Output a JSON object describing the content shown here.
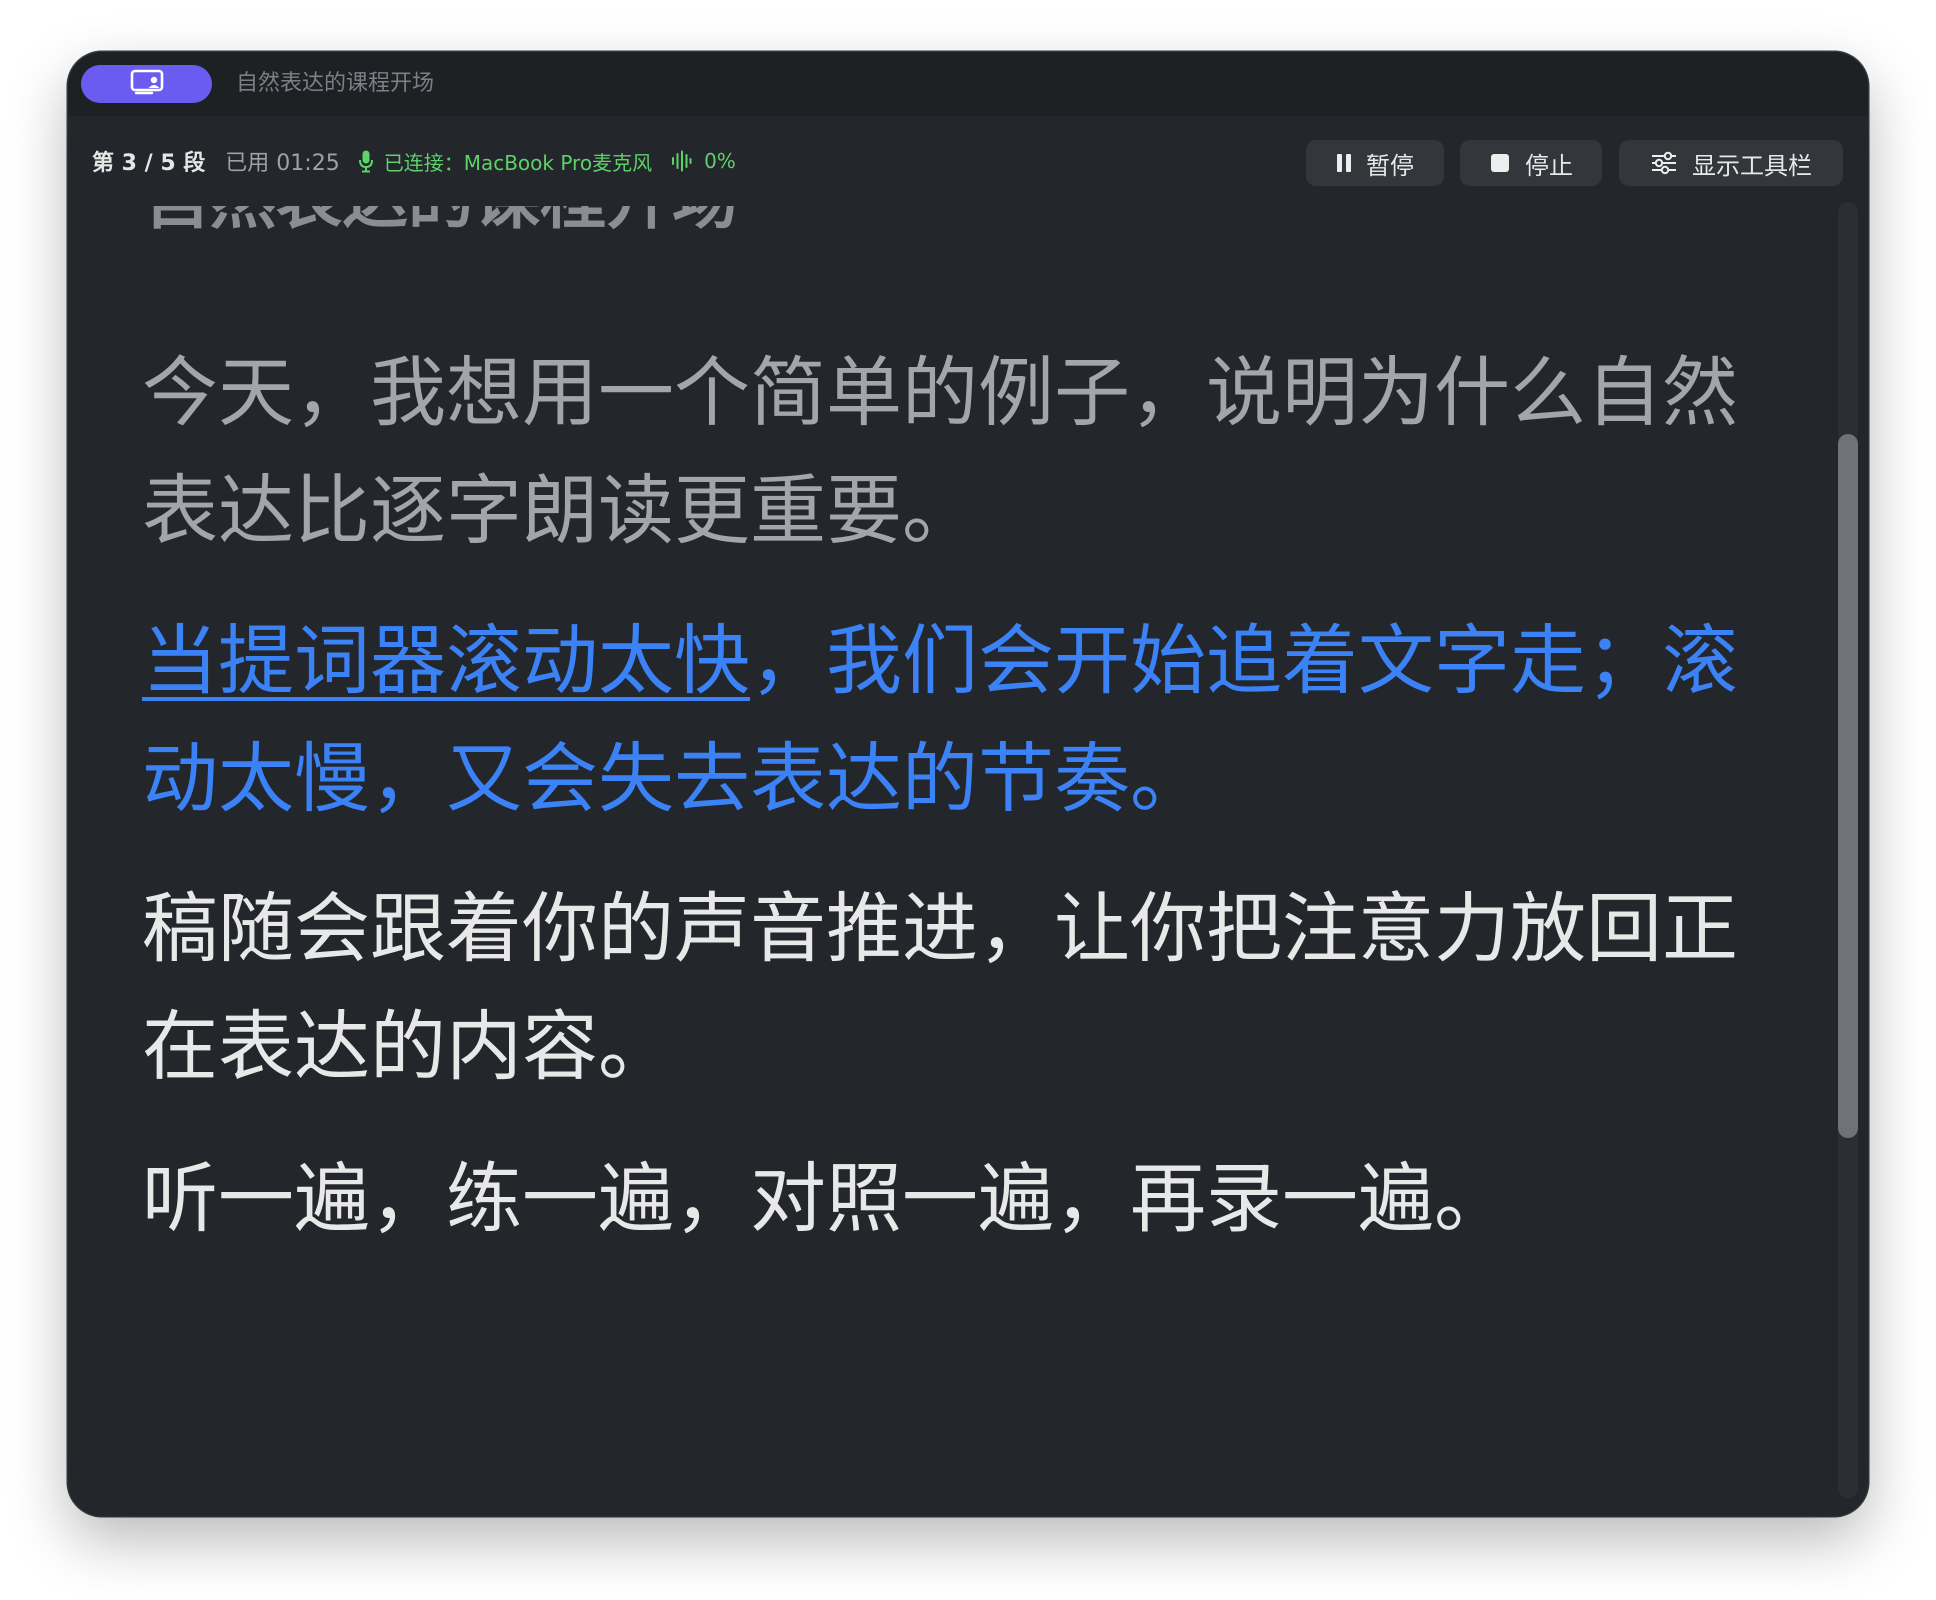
{
  "titlebar": {
    "app_icon": "teleprompter-screen-icon",
    "title": "自然表达的课程开场"
  },
  "status": {
    "segment": "第 3 / 5 段",
    "elapsed": "已用 01:25",
    "mic_icon": "microphone-icon",
    "connected": "已连接：MacBook Pro麦克风",
    "level_icon": "audio-level-icon",
    "level": "0%",
    "accent_green": "#5dd16a"
  },
  "controls": {
    "pause_label": "暂停",
    "stop_label": "停止",
    "toolbar_label": "显示工具栏"
  },
  "script": {
    "heading": "自然表达的课程开场",
    "paragraphs": [
      "今天，我想用一个简单的例子，说明为什么自然表达比逐字朗读更重要。",
      "当提词器滚动太快，我们会开始追着文字走；滚动太慢，又会失去表达的节奏。",
      "稿随会跟着你的声音推进，让你把注意力放回正在表达的内容。",
      "听一遍，练一遍，对照一遍，再录一遍。"
    ],
    "current_phrase": "当提词器滚动太快",
    "current_rest": "，我们会开始追着文字走；滚动太慢，又会失去表达的节奏。",
    "highlight_color": "#3b82f6"
  },
  "colors": {
    "background": "#23262a",
    "app_accent": "#6a5cf0"
  }
}
